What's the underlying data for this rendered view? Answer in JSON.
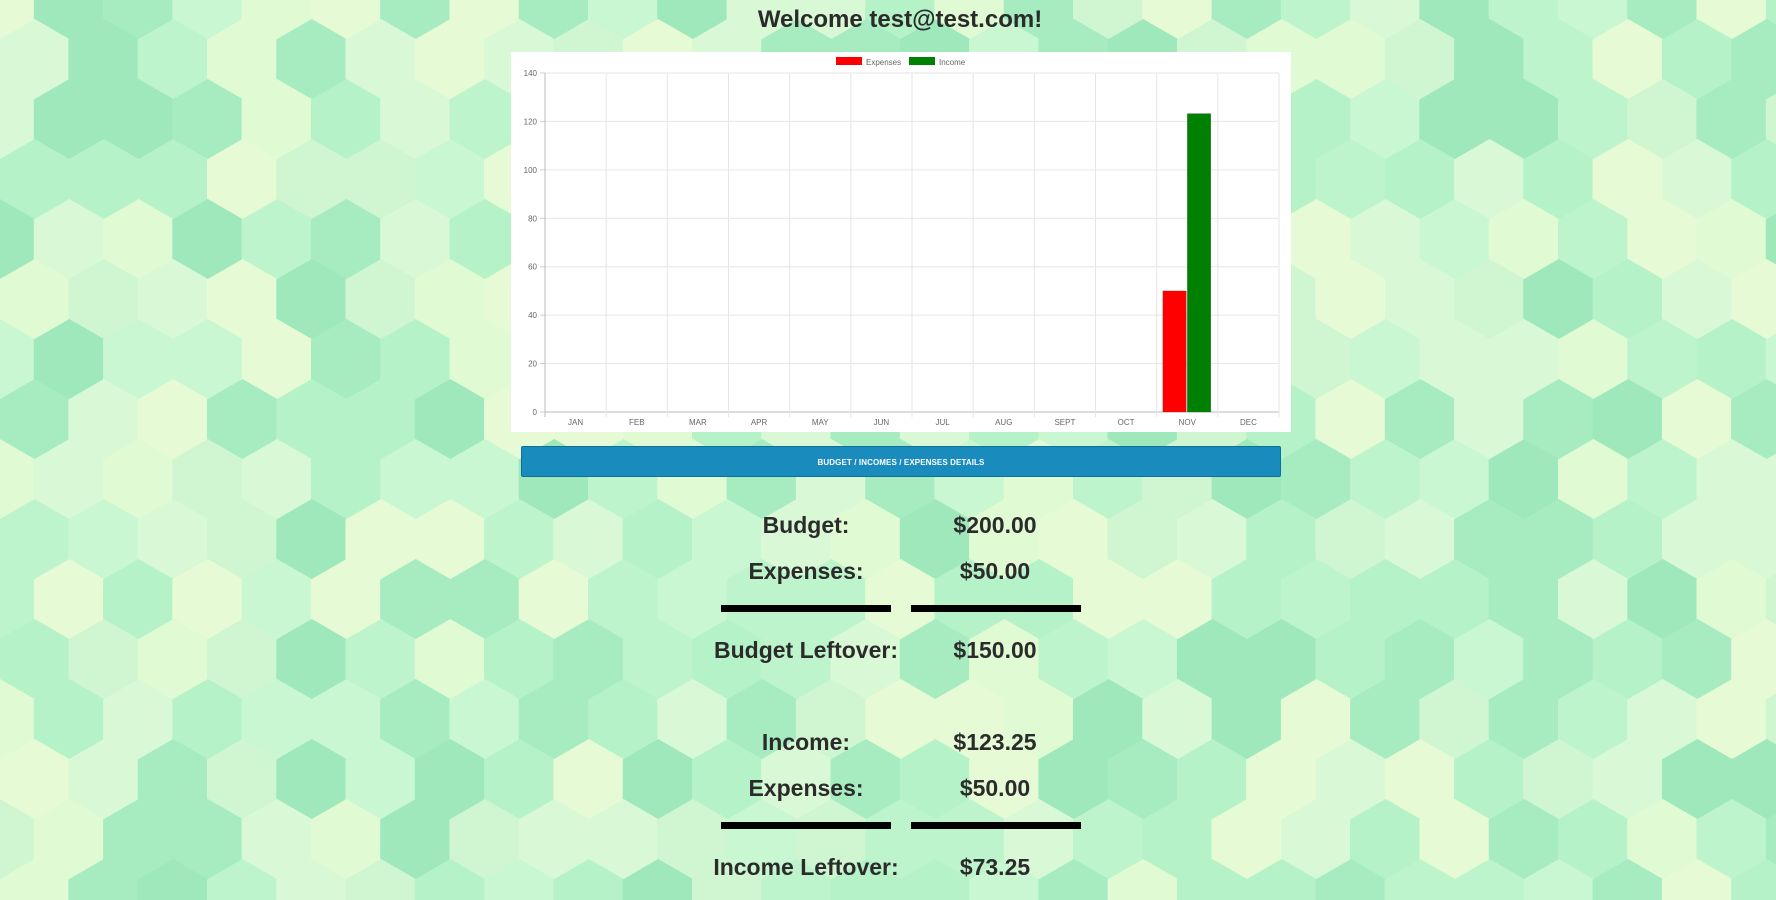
{
  "header": {
    "welcome_text": "Welcome test@test.com!"
  },
  "chart_data": {
    "type": "bar",
    "categories": [
      "JAN",
      "FEB",
      "MAR",
      "APR",
      "MAY",
      "JUN",
      "JUL",
      "AUG",
      "SEPT",
      "OCT",
      "NOV",
      "DEC"
    ],
    "series": [
      {
        "name": "Expenses",
        "color": "#ff0000",
        "values": [
          0,
          0,
          0,
          0,
          0,
          0,
          0,
          0,
          0,
          0,
          50,
          0
        ]
      },
      {
        "name": "Income",
        "color": "#008000",
        "values": [
          0,
          0,
          0,
          0,
          0,
          0,
          0,
          0,
          0,
          0,
          123.25,
          0
        ]
      }
    ],
    "yticks": [
      "0",
      "20",
      "40",
      "60",
      "80",
      "100",
      "120",
      "140"
    ],
    "ylim": [
      0,
      140
    ],
    "grid": true,
    "legend_position": "top"
  },
  "details_button": {
    "label": "BUDGET / INCOMES / EXPENSES DETAILS"
  },
  "budget_summary": {
    "budget_label": "Budget:",
    "budget_value": "$200.00",
    "expenses_label": "Expenses:",
    "expenses_value": "$50.00",
    "leftover_label": "Budget Leftover:",
    "leftover_value": "$150.00"
  },
  "income_summary": {
    "income_label": "Income:",
    "income_value": "$123.25",
    "expenses_label": "Expenses:",
    "expenses_value": "$50.00",
    "leftover_label": "Income Leftover:",
    "leftover_value": "$73.25"
  },
  "colors": {
    "button": "#1a8bbd",
    "expenses": "#ff0000",
    "income": "#008000"
  }
}
